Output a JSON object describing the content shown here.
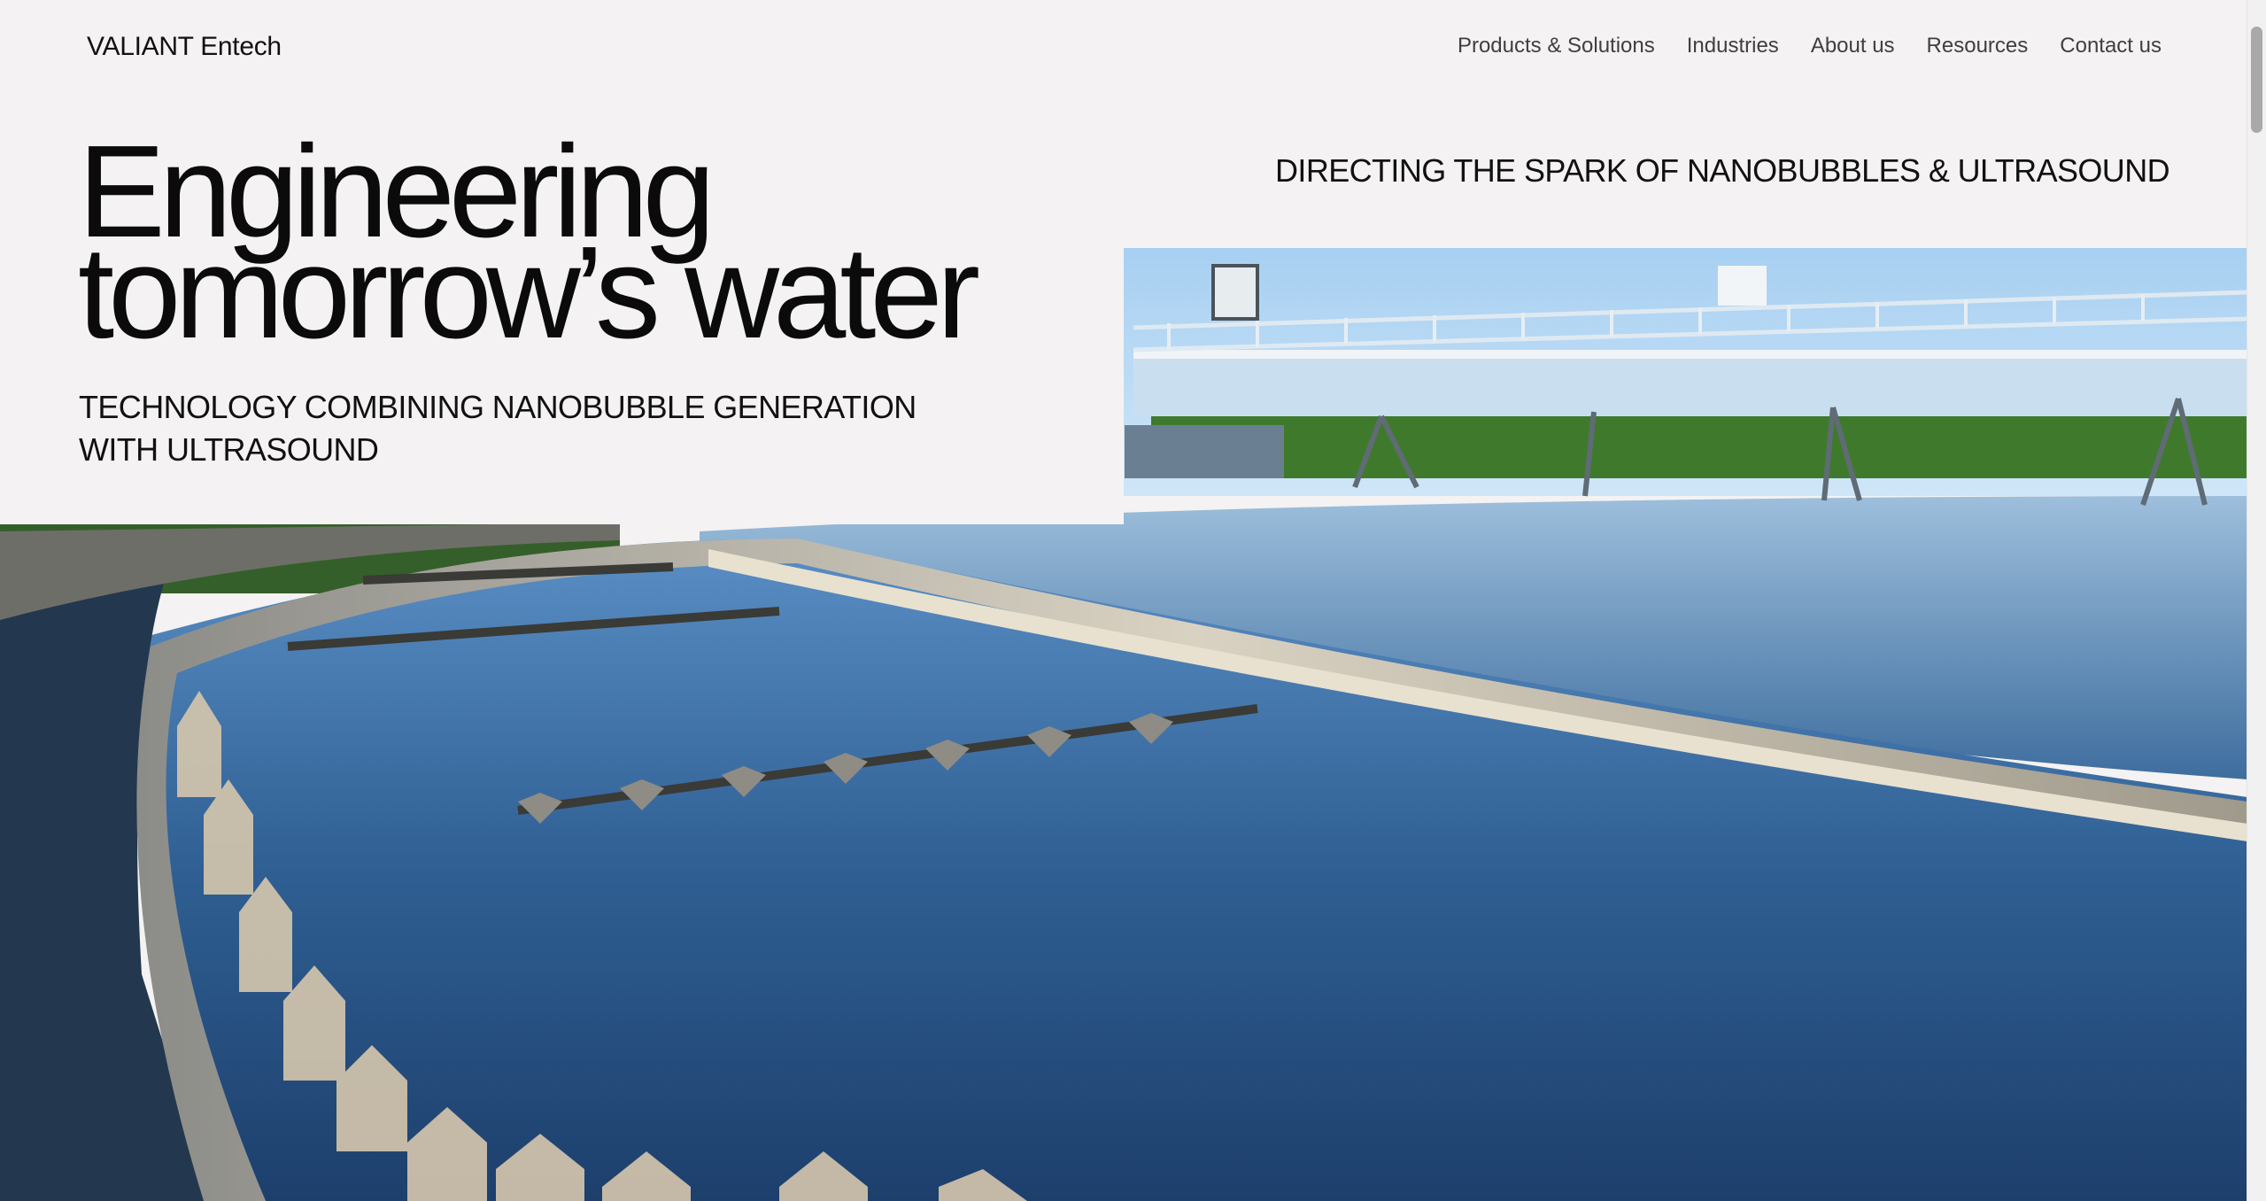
{
  "brand": {
    "name": "VALIANT Entech"
  },
  "nav": {
    "items": [
      {
        "label": "Products & Solutions"
      },
      {
        "label": "Industries"
      },
      {
        "label": "About us"
      },
      {
        "label": "Resources"
      },
      {
        "label": "Contact us"
      }
    ]
  },
  "hero": {
    "title_line1": "Engineering",
    "title_line2": "tomorrow’s water",
    "subtitle_line1": "TECHNOLOGY COMBINING NANOBUBBLE GENERATION",
    "subtitle_line2": "WITH ULTRASOUND",
    "tagline": "DIRECTING THE SPARK OF NANOBUBBLES & ULTRASOUND"
  },
  "colors": {
    "page_background": "#f4f2f2",
    "text": "#111111",
    "nav_text": "#3f3f3f",
    "sky": "#a8d2f0",
    "water": "#2f5f93"
  }
}
